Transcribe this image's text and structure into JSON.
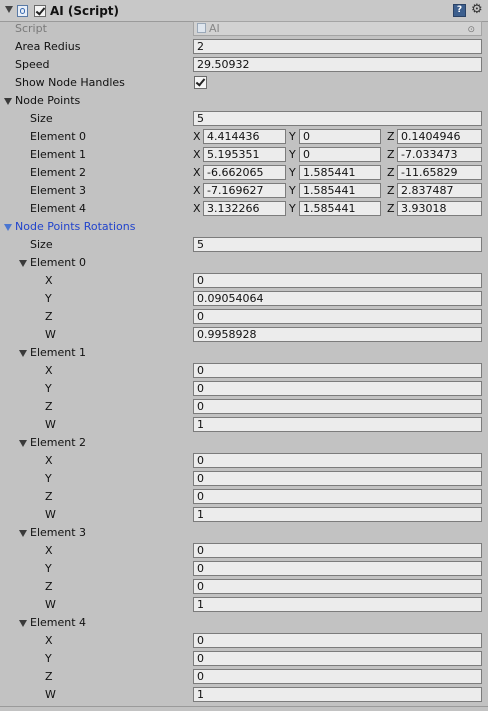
{
  "component": {
    "title": "AI (Script)",
    "enabled": true
  },
  "script_field": {
    "label": "Script",
    "value": "AI"
  },
  "area_radius": {
    "label": "Area Redius",
    "value": "2"
  },
  "speed": {
    "label": "Speed",
    "value": "29.50932"
  },
  "show_node_handles": {
    "label": "Show Node Handles",
    "checked": true
  },
  "node_points": {
    "label": "Node Points",
    "size_label": "Size",
    "size": "5",
    "axis_labels": [
      "X",
      "Y",
      "Z"
    ],
    "elements": [
      {
        "label": "Element 0",
        "x": "4.414436",
        "y": "0",
        "z": "0.1404946"
      },
      {
        "label": "Element 1",
        "x": "5.195351",
        "y": "0",
        "z": "-7.033473"
      },
      {
        "label": "Element 2",
        "x": "-6.662065",
        "y": "1.585441",
        "z": "-11.65829"
      },
      {
        "label": "Element 3",
        "x": "-7.169627",
        "y": "1.585441",
        "z": "2.837487"
      },
      {
        "label": "Element 4",
        "x": "3.132266",
        "y": "1.585441",
        "z": "3.93018"
      }
    ]
  },
  "node_points_rotations": {
    "label": "Node Points Rotations",
    "size_label": "Size",
    "size": "5",
    "component_labels": [
      "X",
      "Y",
      "Z",
      "W"
    ],
    "elements": [
      {
        "label": "Element 0",
        "x": "0",
        "y": "0.09054064",
        "z": "0",
        "w": "0.9958928"
      },
      {
        "label": "Element 1",
        "x": "0",
        "y": "0",
        "z": "0",
        "w": "1"
      },
      {
        "label": "Element 2",
        "x": "0",
        "y": "0",
        "z": "0",
        "w": "1"
      },
      {
        "label": "Element 3",
        "x": "0",
        "y": "0",
        "z": "0",
        "w": "1"
      },
      {
        "label": "Element 4",
        "x": "0",
        "y": "0",
        "z": "0",
        "w": "1"
      }
    ]
  },
  "colors": {
    "highlight_label": "#2244cc",
    "panel_bg": "#c2c2c2"
  },
  "icons": [
    "foldout-arrow-icon",
    "script-icon",
    "help-book-icon",
    "gear-icon",
    "object-target-icon"
  ]
}
